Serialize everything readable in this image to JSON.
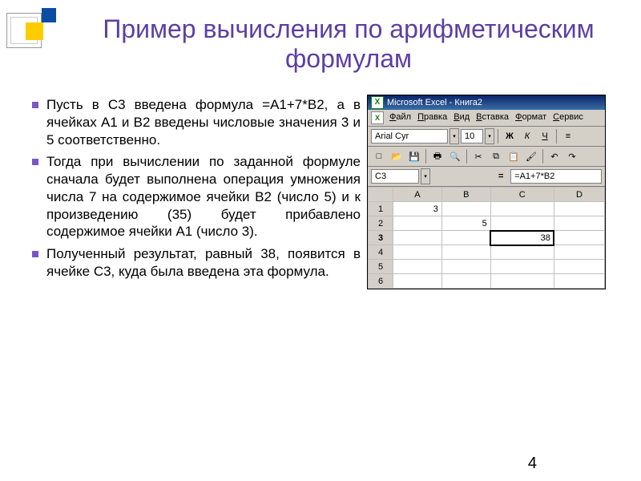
{
  "slide": {
    "title": "Пример вычисления по арифметическим формулам",
    "page_number": "4"
  },
  "bullets": [
    "Пусть в С3 введена формула =А1+7*В2, а в ячейках А1 и В2 введены числовые значения 3 и 5 соответственно.",
    "Тогда при вычислении по заданной формуле сначала будет выполнена операция умножения числа 7 на содержимое ячейки В2 (число 5) и к произведению (35) будет прибавлено содержимое ячейки А1 (число 3).",
    "Полученный результат, равный 38, появится в ячейке С3, куда была введена эта формула."
  ],
  "excel": {
    "title": "Microsoft Excel - Книга2",
    "menu": [
      "Файл",
      "Правка",
      "Вид",
      "Вставка",
      "Формат",
      "Сервис"
    ],
    "font_name": "Arial Cyr",
    "font_size": "10",
    "name_box": "C3",
    "fx_label": "=",
    "formula": "=A1+7*B2",
    "columns": [
      "A",
      "B",
      "C",
      "D"
    ],
    "rows": [
      "1",
      "2",
      "3",
      "4",
      "5",
      "6"
    ],
    "cells": {
      "A1": "3",
      "B2": "5",
      "C3": "38"
    }
  }
}
